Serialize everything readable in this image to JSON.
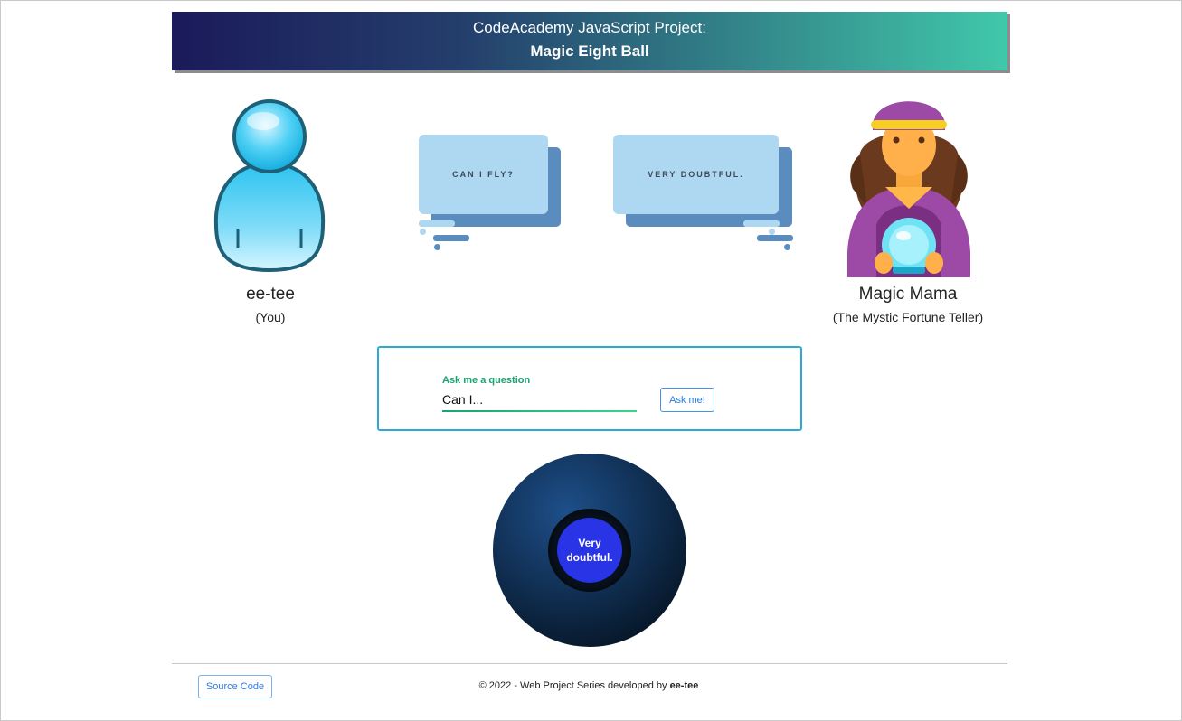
{
  "header": {
    "line1": "CodeAcademy JavaScript Project:",
    "line2": "Magic Eight Ball"
  },
  "user": {
    "name": "ee-tee",
    "subtitle": "(You)",
    "icon": "user-avatar-icon"
  },
  "fortune_teller": {
    "name": "Magic Mama",
    "subtitle": "(The Mystic Fortune Teller)",
    "icon": "fortune-teller-icon"
  },
  "bubbles": {
    "question": "CAN I FLY?",
    "answer": "VERY DOUBTFUL."
  },
  "ask_form": {
    "label": "Ask me a question",
    "value": "Can I...",
    "button_label": "Ask me!"
  },
  "eight_ball": {
    "answer": "Very doubtful."
  },
  "footer": {
    "source_button": "Source Code",
    "copyright_prefix": "© 2022 - Web Project Series developed by ",
    "author": "ee-tee"
  },
  "colors": {
    "accent": "#2b7be0",
    "label_green": "#1aa36f",
    "ball_answer": "#2934e6"
  }
}
